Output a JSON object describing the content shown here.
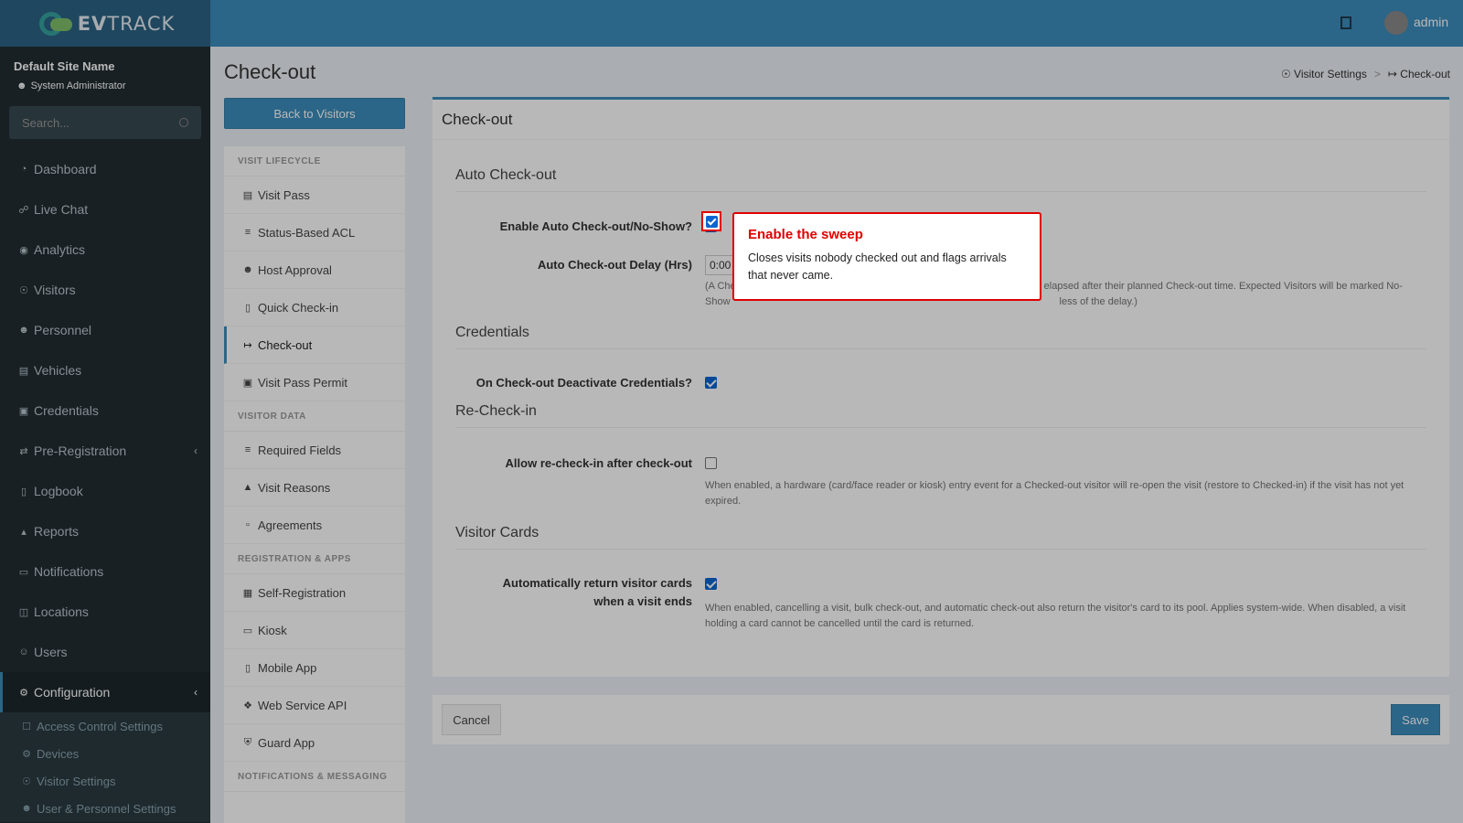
{
  "brand": {
    "name_bold": "EV",
    "name_rest": "TRACK"
  },
  "header": {
    "user": "admin"
  },
  "sidebar": {
    "site_name": "Default Site Name",
    "role": "System Administrator",
    "search_placeholder": "Search...",
    "items": [
      {
        "label": "Dashboard",
        "icon": "dashboard-icon"
      },
      {
        "label": "Live Chat",
        "icon": "headset-icon"
      },
      {
        "label": "Analytics",
        "icon": "analytics-icon"
      },
      {
        "label": "Visitors",
        "icon": "eye-icon"
      },
      {
        "label": "Personnel",
        "icon": "personnel-icon"
      },
      {
        "label": "Vehicles",
        "icon": "car-icon"
      },
      {
        "label": "Credentials",
        "icon": "id-card-icon"
      },
      {
        "label": "Pre-Registration",
        "icon": "exchange-icon"
      },
      {
        "label": "Logbook",
        "icon": "book-icon"
      },
      {
        "label": "Reports",
        "icon": "reports-icon"
      },
      {
        "label": "Notifications",
        "icon": "notifications-icon"
      },
      {
        "label": "Locations",
        "icon": "map-icon"
      },
      {
        "label": "Users",
        "icon": "users-icon"
      },
      {
        "label": "Configuration",
        "icon": "gear-icon"
      }
    ],
    "sub_items": [
      {
        "label": "Access Control Settings",
        "icon": "lock-icon"
      },
      {
        "label": "Devices",
        "icon": "cog-icon"
      },
      {
        "label": "Visitor Settings",
        "icon": "eye-icon"
      },
      {
        "label": "User & Personnel Settings",
        "icon": "user-cog-icon"
      }
    ]
  },
  "page": {
    "title": "Check-out",
    "back_button": "Back to Visitors",
    "breadcrumb": [
      "Visitor Settings",
      "Check-out"
    ]
  },
  "settings_nav": {
    "groups": [
      {
        "heading": "VISIT LIFECYCLE",
        "items": [
          "Visit Pass",
          "Status-Based ACL",
          "Host Approval",
          "Quick Check-in",
          "Check-out",
          "Visit Pass Permit"
        ]
      },
      {
        "heading": "VISITOR DATA",
        "items": [
          "Required Fields",
          "Visit Reasons",
          "Agreements"
        ]
      },
      {
        "heading": "REGISTRATION & APPS",
        "items": [
          "Self-Registration",
          "Kiosk",
          "Mobile App",
          "Web Service API",
          "Guard App"
        ]
      },
      {
        "heading": "NOTIFICATIONS & MESSAGING",
        "items": []
      }
    ],
    "active": "Check-out"
  },
  "form": {
    "box_title": "Check-out",
    "sections": {
      "auto": "Auto Check-out",
      "credentials": "Credentials",
      "recheckin": "Re-Check-in",
      "cards": "Visitor Cards"
    },
    "enable_auto_label": "Enable Auto Check-out/No-Show?",
    "enable_auto_checked": true,
    "delay_label": "Auto Check-out Delay (Hrs)",
    "delay_value": "0:00",
    "delay_help_line1_start": "(A Che",
    "delay_help_line1_end": "elapsed after their planned Check-out time. Expected Visitors will be marked No-",
    "delay_help_line2_start": "Show",
    "delay_help_line2_end": "less of the delay.)",
    "deactivate_label": "On Check-out Deactivate Credentials?",
    "deactivate_checked": true,
    "recheckin_label": "Allow re-check-in after check-out",
    "recheckin_checked": false,
    "recheckin_help": "When enabled, a hardware (card/face reader or kiosk) entry event for a Checked-out visitor will re-open the visit (restore to Checked-in) if the visit has not yet expired.",
    "return_cards_label": "Automatically return visitor cards when a visit ends",
    "return_cards_checked": true,
    "return_cards_help": "When enabled, cancelling a visit, bulk check-out, and automatic check-out also return the visitor's card to its pool. Applies system-wide. When disabled, a visit holding a card cannot be cancelled until the card is returned."
  },
  "footer": {
    "cancel": "Cancel",
    "save": "Save"
  },
  "tooltip": {
    "title": "Enable the sweep",
    "body": "Closes visits nobody checked out and flags arrivals that never came."
  },
  "colors": {
    "accent": "#3c8dbc",
    "sidebar": "#222d32",
    "highlight": "#e00000"
  }
}
